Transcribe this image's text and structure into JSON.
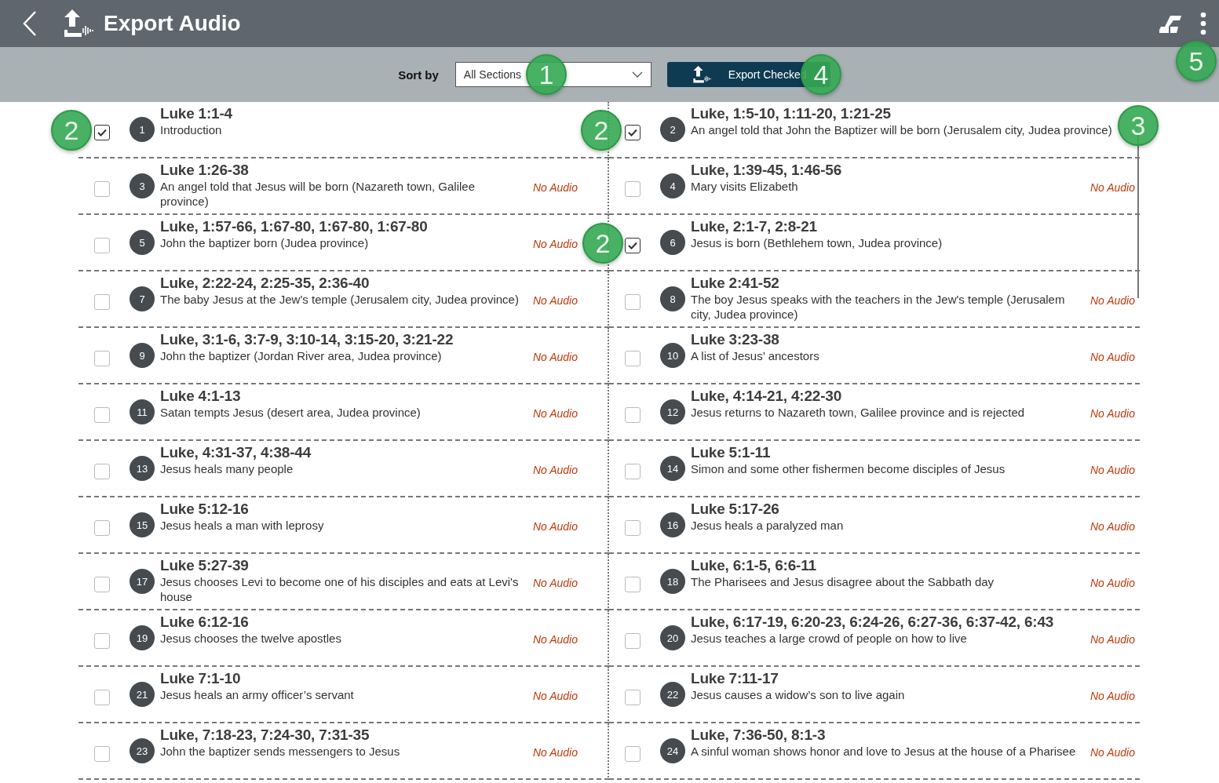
{
  "header": {
    "title": "Export Audio"
  },
  "toolbar": {
    "sort_label": "Sort by",
    "sort_value": "All Sections",
    "export_button": "Export Checked"
  },
  "sections": [
    {
      "number": "1",
      "reference": "Luke 1:1-4",
      "description": "Introduction",
      "checked": true
    },
    {
      "number": "2",
      "reference": "Luke, 1:5-10, 1:11-20, 1:21-25",
      "description": "An angel told that John the Baptizer will be born (Jerusalem city, Judea province)",
      "checked": true
    },
    {
      "number": "3",
      "reference": "Luke 1:26-38",
      "description": "An angel told that Jesus will be born (Nazareth town, Galilee province)",
      "checked": false,
      "status": "No Audio"
    },
    {
      "number": "4",
      "reference": "Luke, 1:39-45, 1:46-56",
      "description": "Mary visits Elizabeth",
      "checked": false,
      "status": "No Audio"
    },
    {
      "number": "5",
      "reference": "Luke, 1:57-66, 1:67-80, 1:67-80, 1:67-80",
      "description": "John the baptizer born (Judea province)",
      "checked": false,
      "status": "No Audio"
    },
    {
      "number": "6",
      "reference": "Luke, 2:1-7, 2:8-21",
      "description": "Jesus is born (Bethlehem town, Judea province)",
      "checked": true
    },
    {
      "number": "7",
      "reference": "Luke, 2:22-24, 2:25-35, 2:36-40",
      "description": "The baby Jesus at the Jew's temple (Jerusalem city, Judea province)",
      "checked": false,
      "status": "No Audio"
    },
    {
      "number": "8",
      "reference": "Luke 2:41-52",
      "description": "The boy Jesus speaks with the teachers in the Jew's temple (Jerusalem city, Judea province)",
      "checked": false,
      "status": "No Audio"
    },
    {
      "number": "9",
      "reference": "Luke, 3:1-6, 3:7-9, 3:10-14, 3:15-20, 3:21-22",
      "description": "John the baptizer (Jordan River area, Judea province)",
      "checked": false,
      "status": "No Audio"
    },
    {
      "number": "10",
      "reference": "Luke 3:23-38",
      "description": "A list of Jesus’ ancestors",
      "checked": false,
      "status": "No Audio"
    },
    {
      "number": "11",
      "reference": "Luke 4:1-13",
      "description": "Satan tempts Jesus (desert area, Judea province)",
      "checked": false,
      "status": "No Audio"
    },
    {
      "number": "12",
      "reference": "Luke, 4:14-21, 4:22-30",
      "description": "Jesus returns to Nazareth town, Galilee province and is rejected",
      "checked": false,
      "status": "No Audio"
    },
    {
      "number": "13",
      "reference": "Luke, 4:31-37, 4:38-44",
      "description": "Jesus heals many people",
      "checked": false,
      "status": "No Audio"
    },
    {
      "number": "14",
      "reference": "Luke 5:1-11",
      "description": "Simon and some other fishermen become disciples of Jesus",
      "checked": false,
      "status": "No Audio"
    },
    {
      "number": "15",
      "reference": "Luke 5:12-16",
      "description": "Jesus heals a man with leprosy",
      "checked": false,
      "status": "No Audio"
    },
    {
      "number": "16",
      "reference": "Luke 5:17-26",
      "description": "Jesus heals a paralyzed man",
      "checked": false,
      "status": "No Audio"
    },
    {
      "number": "17",
      "reference": "Luke 5:27-39",
      "description": "Jesus chooses Levi to become one of his disciples and eats at Levi's house",
      "checked": false,
      "status": "No Audio"
    },
    {
      "number": "18",
      "reference": "Luke, 6:1-5, 6:6-11",
      "description": "The Pharisees and Jesus disagree about the Sabbath day",
      "checked": false,
      "status": "No Audio"
    },
    {
      "number": "19",
      "reference": "Luke 6:12-16",
      "description": "Jesus chooses the twelve apostles",
      "checked": false,
      "status": "No Audio"
    },
    {
      "number": "20",
      "reference": "Luke, 6:17-19, 6:20-23, 6:24-26, 6:27-36, 6:37-42, 6:43",
      "description": "Jesus teaches a large crowd of people on how to live",
      "checked": false,
      "status": "No Audio"
    },
    {
      "number": "21",
      "reference": "Luke 7:1-10",
      "description": "Jesus heals an army officer’s servant",
      "checked": false,
      "status": "No Audio"
    },
    {
      "number": "22",
      "reference": "Luke 7:11-17",
      "description": "Jesus causes a widow’s son to live again",
      "checked": false,
      "status": "No Audio"
    },
    {
      "number": "23",
      "reference": "Luke, 7:18-23, 7:24-30, 7:31-35",
      "description": "John the baptizer sends messengers to Jesus",
      "checked": false,
      "status": "No Audio"
    },
    {
      "number": "24",
      "reference": "Luke, 7:36-50, 8:1-3",
      "description": "A sinful woman shows honor and love to Jesus at the house of a Pharisee",
      "checked": false,
      "status": "No Audio"
    }
  ],
  "callouts": [
    {
      "label": "1"
    },
    {
      "label": "2"
    },
    {
      "label": "2"
    },
    {
      "label": "2"
    },
    {
      "label": "3"
    },
    {
      "label": "4"
    },
    {
      "label": "5"
    }
  ]
}
